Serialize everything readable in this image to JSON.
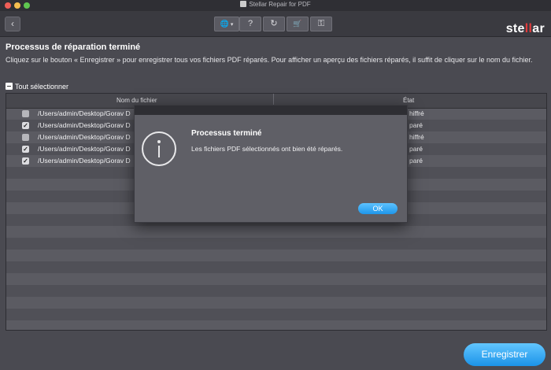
{
  "window": {
    "title": "Stellar Repair for PDF"
  },
  "toolbar": {
    "back_icon": "chevron-left-icon",
    "buttons": [
      {
        "icon": "globe-icon",
        "glyph": "🌐",
        "label": "▾"
      },
      {
        "icon": "help-icon",
        "glyph": "?"
      },
      {
        "icon": "refresh-icon",
        "glyph": "↻"
      },
      {
        "icon": "cart-icon",
        "glyph": "🛒"
      },
      {
        "icon": "key-icon",
        "glyph": "⚿"
      }
    ],
    "brand_pre": "ste",
    "brand_mid": "ll",
    "brand_post": "ar"
  },
  "main": {
    "heading": "Processus de réparation terminé",
    "description": "Cliquez sur le bouton « Enregistrer » pour enregistrer tous vos fichiers PDF réparés. Pour afficher un aperçu des fichiers réparés, il suffit de cliquer sur le nom du fichier.",
    "select_all": "Tout sélectionner"
  },
  "table": {
    "headers": {
      "name": "Nom du fichier",
      "state": "État"
    },
    "rows": [
      {
        "checked": false,
        "path": "/Users/admin/Desktop/Gorav D",
        "state": "hiffré"
      },
      {
        "checked": true,
        "path": "/Users/admin/Desktop/Gorav D",
        "state": "paré"
      },
      {
        "checked": false,
        "path": "/Users/admin/Desktop/Gorav D",
        "state": "hiffré"
      },
      {
        "checked": true,
        "path": "/Users/admin/Desktop/Gorav D",
        "state": "paré"
      },
      {
        "checked": true,
        "path": "/Users/admin/Desktop/Gorav D",
        "state": "paré"
      }
    ]
  },
  "dialog": {
    "icon": "info-icon",
    "title": "Processus terminé",
    "message": "Les fichiers PDF sélectionnés ont bien été réparés.",
    "ok_label": "OK"
  },
  "footer": {
    "save_label": "Enregistrer"
  }
}
